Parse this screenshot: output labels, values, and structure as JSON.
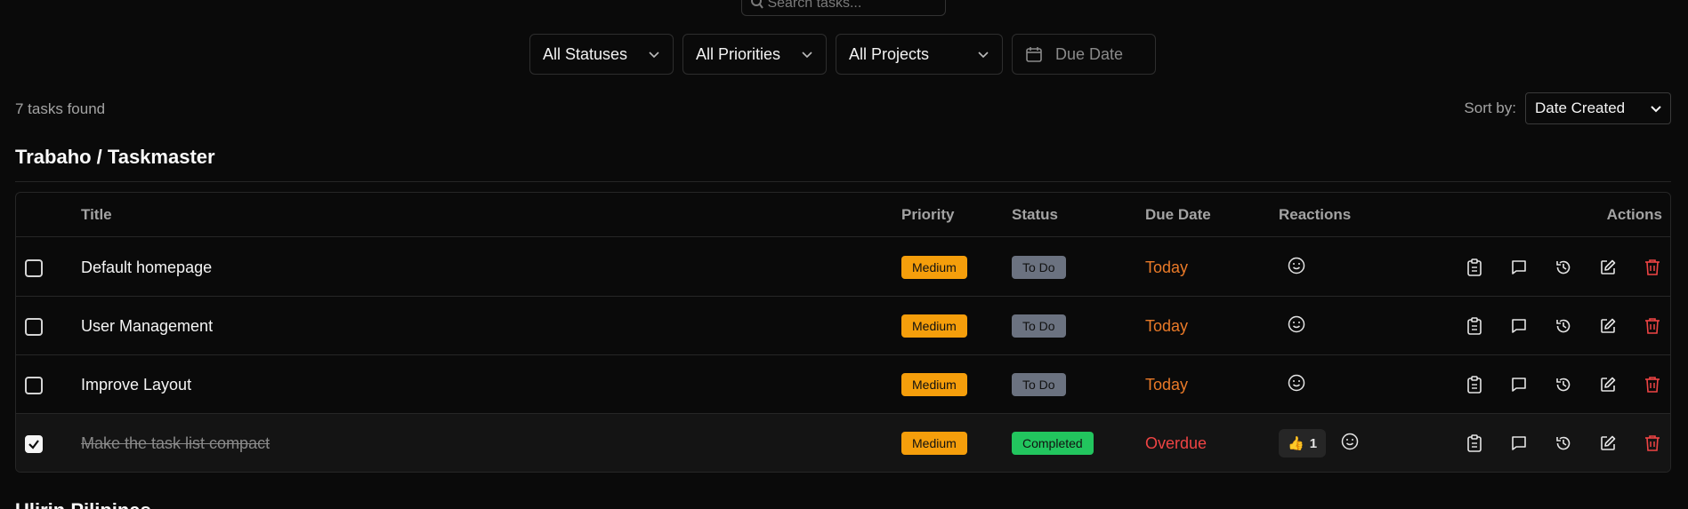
{
  "search": {
    "placeholder": "Search tasks..."
  },
  "filters": {
    "status": "All Statuses",
    "priority": "All Priorities",
    "project": "All Projects",
    "due_date": "Due Date"
  },
  "summary": {
    "count_text": "7 tasks found"
  },
  "sort": {
    "label": "Sort by:",
    "value": "Date Created"
  },
  "group": {
    "title": "Trabaho / Taskmaster"
  },
  "next_group": {
    "title": "Ulirin Pilipinas"
  },
  "table": {
    "headers": {
      "title": "Title",
      "priority": "Priority",
      "status": "Status",
      "due_date": "Due Date",
      "reactions": "Reactions",
      "actions": "Actions"
    },
    "rows": [
      {
        "title": "Default homepage",
        "checked": false,
        "priority": "Medium",
        "status": "To Do",
        "due": "Today"
      },
      {
        "title": "User Management",
        "checked": false,
        "priority": "Medium",
        "status": "To Do",
        "due": "Today"
      },
      {
        "title": "Improve Layout",
        "checked": false,
        "priority": "Medium",
        "status": "To Do",
        "due": "Today"
      },
      {
        "title": "Make the task list compact",
        "checked": true,
        "priority": "Medium",
        "status": "Completed",
        "due": "Overdue",
        "reaction": {
          "emoji": "👍",
          "count": "1"
        }
      }
    ]
  },
  "colors": {
    "priority_medium": "#f59e0b",
    "status_todo": "#6b7280",
    "status_completed": "#22c55e",
    "due_today": "#ea7a28",
    "due_overdue": "#ef4444",
    "delete": "#ef4444"
  },
  "icons": [
    "search-icon",
    "chevron-down-icon",
    "calendar-icon",
    "smile-icon",
    "clipboard-icon",
    "comment-icon",
    "history-icon",
    "edit-icon",
    "trash-icon",
    "check-icon"
  ]
}
